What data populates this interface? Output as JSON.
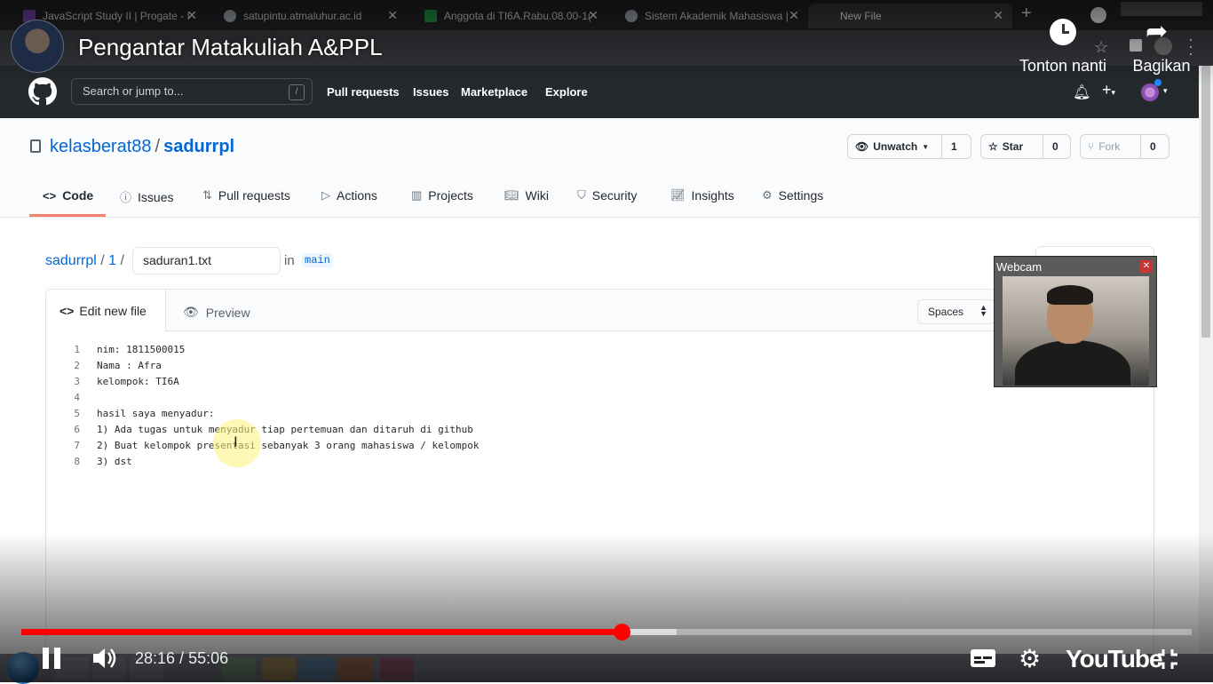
{
  "browser": {
    "tabs": [
      {
        "title": "JavaScript Study II | Progate - I",
        "favicon_color": "#6b3fa0",
        "active": false
      },
      {
        "title": "satupintu.atmaluhur.ac.id",
        "favicon_color": "#9aa0a6",
        "active": false
      },
      {
        "title": "Anggota di TI6A.Rabu.08.00-1(",
        "favicon_color": "#1e8e3e",
        "active": false
      },
      {
        "title": "Sistem Akademik Mahasiswa |",
        "favicon_color": "#9aa0a6",
        "active": false
      },
      {
        "title": "New File",
        "favicon_color": "#35363a",
        "active": true
      }
    ],
    "new_tab_glyph": "+"
  },
  "github": {
    "search_placeholder": "Search or jump to...",
    "search_key": "/",
    "nav": [
      "Pull requests",
      "Issues",
      "Marketplace",
      "Explore"
    ],
    "repo_owner": "kelasberat88",
    "repo_sep": "/",
    "repo_name": "sadurrpl",
    "watch": {
      "label": "Unwatch",
      "count": "1"
    },
    "star": {
      "label": "Star",
      "count": "0"
    },
    "fork": {
      "label": "Fork",
      "count": "0"
    },
    "tabs": [
      "Code",
      "Issues",
      "Pull requests",
      "Actions",
      "Projects",
      "Wiki",
      "Security",
      "Insights",
      "Settings"
    ],
    "active_tab": "Code"
  },
  "editor": {
    "path_root": "sadurrpl",
    "path_dir": "1",
    "path_sep": "/",
    "filename": "saduran1.txt",
    "in_word": "in",
    "branch": "main",
    "edit_tab": "Edit new file",
    "preview_tab": "Preview",
    "indent_mode": "Spaces",
    "lines": [
      {
        "n": "1",
        "text": "nim: 1811500015"
      },
      {
        "n": "2",
        "text": "Nama : Afra"
      },
      {
        "n": "3",
        "text": "kelompok: TI6A"
      },
      {
        "n": "4",
        "text": ""
      },
      {
        "n": "5",
        "text": "hasil saya menyadur:"
      },
      {
        "n": "6",
        "text": "1) Ada tugas untuk menyadur tiap pertemuan dan ditaruh di github"
      },
      {
        "n": "7",
        "text": "2) Buat kelompok presentasi sebanyak 3 orang mahasiswa / kelompok"
      },
      {
        "n": "8",
        "text": "3) dst"
      }
    ]
  },
  "webcam": {
    "title": "Webcam",
    "close_glyph": "✕"
  },
  "youtube": {
    "video_title": "Pengantar Matakuliah A&PPL",
    "watch_later": "Tonton nanti",
    "share": "Bagikan",
    "current_time": "28:16",
    "duration": "55:06",
    "time_sep": " / ",
    "played_fraction": 0.513,
    "buffered_fraction": 0.56,
    "logo_text": "YouTube",
    "accent": "#ff0000"
  }
}
